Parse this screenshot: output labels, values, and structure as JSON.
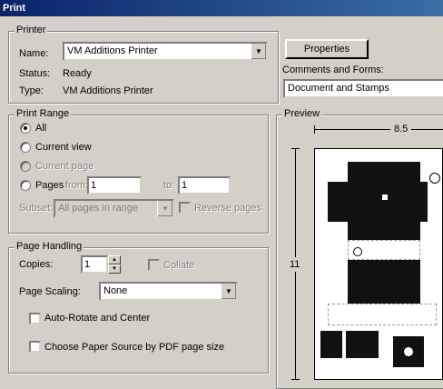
{
  "window": {
    "title": "Print"
  },
  "printer": {
    "group_label": "Printer",
    "name_label": "Name:",
    "name_value": "VM Additions Printer",
    "status_label": "Status:",
    "status_value": "Ready",
    "type_label": "Type:",
    "type_value": "VM Additions Printer",
    "properties_label": "Properties",
    "comments_label": "Comments and Forms:",
    "comments_value": "Document and Stamps"
  },
  "print_range": {
    "group_label": "Print Range",
    "all_label": "All",
    "current_view_label": "Current view",
    "current_page_label": "Current page",
    "pages_label": "Pages",
    "from_label": "from:",
    "from_value": "1",
    "to_label": "to:",
    "to_value": "1",
    "subset_label": "Subset:",
    "subset_value": "All pages in range",
    "reverse_label": "Reverse pages",
    "selected": "All"
  },
  "page_handling": {
    "group_label": "Page Handling",
    "copies_label": "Copies:",
    "copies_value": "1",
    "collate_label": "Collate",
    "scaling_label": "Page Scaling:",
    "scaling_value": "None",
    "auto_rotate_label": "Auto-Rotate and Center",
    "paper_source_label": "Choose Paper Source by PDF page size"
  },
  "preview": {
    "group_label": "Preview",
    "width_label": "8.5",
    "height_label": "11"
  }
}
